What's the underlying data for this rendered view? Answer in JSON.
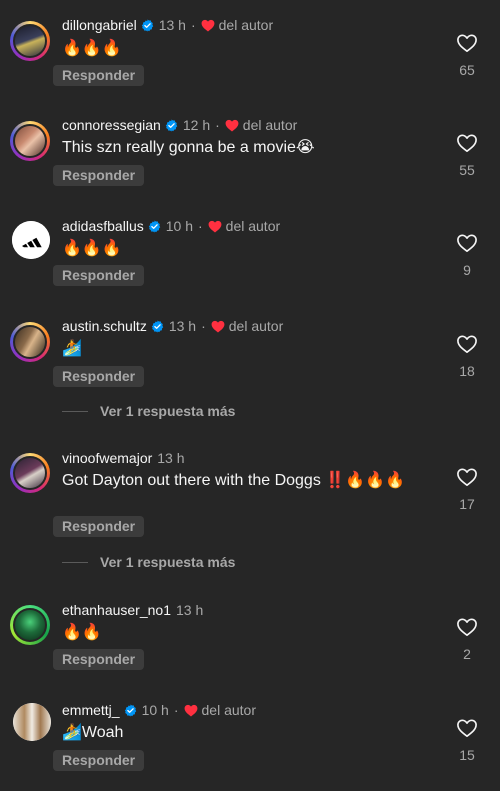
{
  "reply_label": "Responder",
  "view_more_label": "Ver 1 respuesta más",
  "author_label": "del autor",
  "comments": [
    {
      "username": "dillongabriel",
      "verified": true,
      "time": "13 h",
      "liked_by_author": true,
      "text": "🔥🔥🔥",
      "likes": "65"
    },
    {
      "username": "connoressegian",
      "verified": true,
      "time": "12 h",
      "liked_by_author": true,
      "text": "This szn really gonna be a movie😭",
      "likes": "55"
    },
    {
      "username": "adidasfballus",
      "verified": true,
      "time": "10 h",
      "liked_by_author": true,
      "text": "🔥🔥🔥",
      "likes": "9"
    },
    {
      "username": "austin.schultz",
      "verified": true,
      "time": "13 h",
      "liked_by_author": true,
      "text": "🏄",
      "likes": "18"
    },
    {
      "username": "vinoofwemajor",
      "verified": false,
      "time": "13 h",
      "liked_by_author": false,
      "text": "Got Dayton out there with the Doggs ‼️🔥🔥🔥",
      "likes": "17"
    },
    {
      "username": "ethanhauser_no1",
      "verified": false,
      "time": "13 h",
      "liked_by_author": false,
      "text": "🔥🔥",
      "likes": "2"
    },
    {
      "username": "emmettj_",
      "verified": true,
      "time": "10 h",
      "liked_by_author": true,
      "text": "🏄Woah",
      "likes": "15"
    }
  ],
  "colors": {
    "background": "#262626",
    "verified": "#0095f6",
    "heart": "#ff3040",
    "muted": "#a8a8a8"
  }
}
